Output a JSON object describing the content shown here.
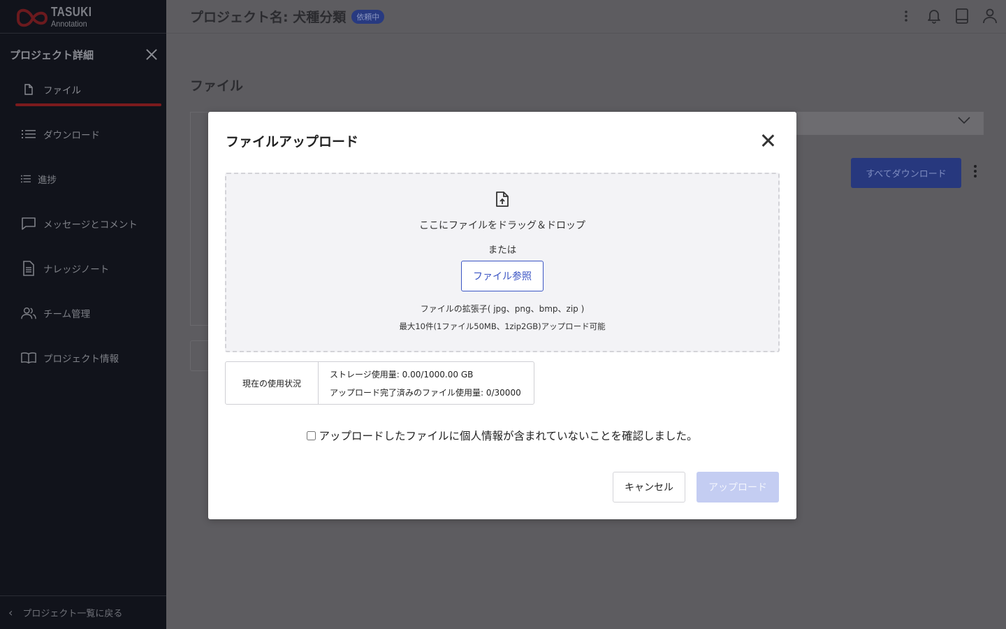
{
  "app": {
    "logo_name": "TASUKI",
    "logo_sub": "Annotation"
  },
  "sidebar": {
    "title": "プロジェクト詳細",
    "items": [
      {
        "label": "ファイル",
        "icon": "file-icon",
        "active": true
      },
      {
        "label": "ダウンロード",
        "icon": "list-icon"
      },
      {
        "label": "進捗",
        "icon": "list-icon"
      },
      {
        "label": "メッセージとコメント",
        "icon": "chat-bubble-icon"
      },
      {
        "label": "ナレッジノート",
        "icon": "document-icon"
      },
      {
        "label": "チーム管理",
        "icon": "team-icon"
      },
      {
        "label": "プロジェクト情報",
        "icon": "book-icon"
      }
    ],
    "footer": "プロジェクト一覧に戻る"
  },
  "header": {
    "project_title": "プロジェクト名: 犬種分類",
    "status_badge": "依頼中"
  },
  "page": {
    "title": "ファイル",
    "download_all": "すべてダウンロード"
  },
  "modal": {
    "title": "ファイルアップロード",
    "drop_text": "ここにファイルをドラッグ＆ドロップ",
    "or_text": "または",
    "browse_label": "ファイル参照",
    "extensions_text": "ファイルの拡張子( jpg、png、bmp、zip )",
    "max_text": "最大10件(1ファイル50MB、1zip2GB)アップロード可能",
    "usage_label": "現在の使用状況",
    "storage_usage": "ストレージ使用量: 0.00/1000.00 GB",
    "file_usage": "アップロード完了済みのファイル使用量: 0/30000",
    "confirm_text": "アップロードしたファイルに個人情報が含まれていないことを確認しました。",
    "cancel_label": "キャンセル",
    "upload_label": "アップロード"
  },
  "colors": {
    "sidebar_bg": "#11131b",
    "accent_red": "#7b1a1d",
    "primary_blue": "#3b55c4",
    "disabled_blue": "#c4cdf2"
  }
}
